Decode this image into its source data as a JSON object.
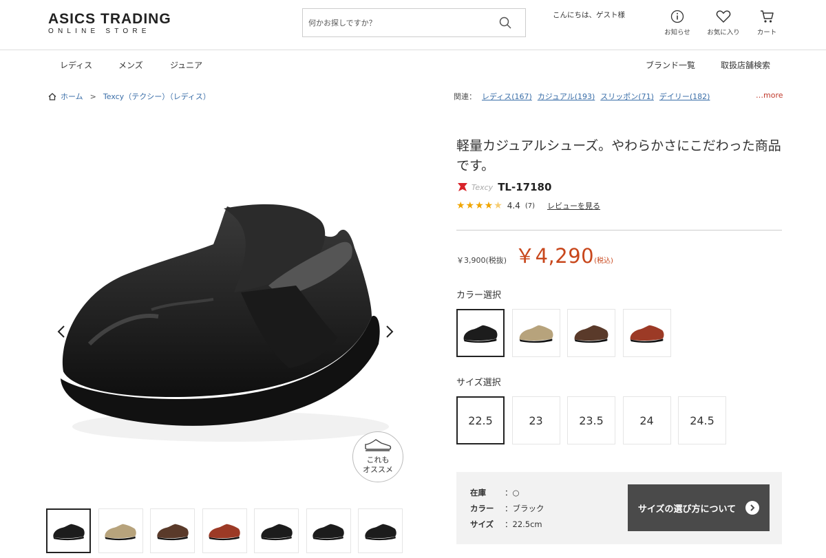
{
  "header": {
    "logo_main": "ASICS TRADING",
    "logo_sub": "ONLINE STORE",
    "search_placeholder": "何かお探しですか？",
    "greeting": "こんにちは、ゲスト様",
    "icons": [
      {
        "label": "お知らせ",
        "icon": "info-icon"
      },
      {
        "label": "お気に入り",
        "icon": "heart-icon"
      },
      {
        "label": "カート",
        "icon": "cart-icon"
      }
    ]
  },
  "nav": {
    "left": [
      "レディス",
      "メンズ",
      "ジュニア"
    ],
    "right": [
      "ブランド一覧",
      "取扱店舗検索"
    ]
  },
  "breadcrumb": {
    "home": "ホーム",
    "separator": ">",
    "current": "Texcy（テクシー）（レディス）"
  },
  "related": {
    "label": "関連：",
    "links": [
      "レディス(167)",
      "カジュアル(193)",
      "スリッポン(71)",
      "デイリー(182)"
    ],
    "more": "…more"
  },
  "product": {
    "title": "軽量カジュアルシューズ。やわらかさにこだわった商品です。",
    "brand": "Texcy",
    "model": "TL-17180",
    "rating": 4.4,
    "rating_display": "4.4",
    "review_count": "(7)",
    "review_link": "レビューを見る",
    "price_ex_tax": "￥3,900(税抜)",
    "price": "￥4,290",
    "tax_label": "(税込)",
    "recommend_label_1": "これも",
    "recommend_label_2": "オススメ"
  },
  "color_section": {
    "label": "カラー選択",
    "options": [
      {
        "name": "ブラック",
        "hex": "#1c1c1c",
        "selected": true
      },
      {
        "name": "ベージュ",
        "hex": "#b7a37c",
        "selected": false
      },
      {
        "name": "ブラウン",
        "hex": "#5a3a2a",
        "selected": false
      },
      {
        "name": "レッド",
        "hex": "#9c3a26",
        "selected": false
      }
    ]
  },
  "size_section": {
    "label": "サイズ選択",
    "sizes": [
      "22.5",
      "23",
      "23.5",
      "24",
      "24.5"
    ],
    "selected": "22.5"
  },
  "info": {
    "stock_key": "在庫",
    "stock_val": "：○",
    "color_key": "カラー",
    "color_val": "：ブラック",
    "size_key": "サイズ",
    "size_val": "：22.5cm",
    "guide_button": "サイズの選び方について"
  },
  "thumbnails": [
    {
      "hex": "#1c1c1c",
      "selected": true
    },
    {
      "hex": "#b7a37c",
      "selected": false
    },
    {
      "hex": "#5a3a2a",
      "selected": false
    },
    {
      "hex": "#9c3a26",
      "selected": false
    },
    {
      "hex": "#1c1c1c",
      "selected": false
    },
    {
      "hex": "#1c1c1c",
      "selected": false
    },
    {
      "hex": "#1c1c1c",
      "selected": false
    }
  ],
  "colors": {
    "accent_price": "#c8471c",
    "link": "#3a6ea8",
    "star": "#f0a500"
  }
}
